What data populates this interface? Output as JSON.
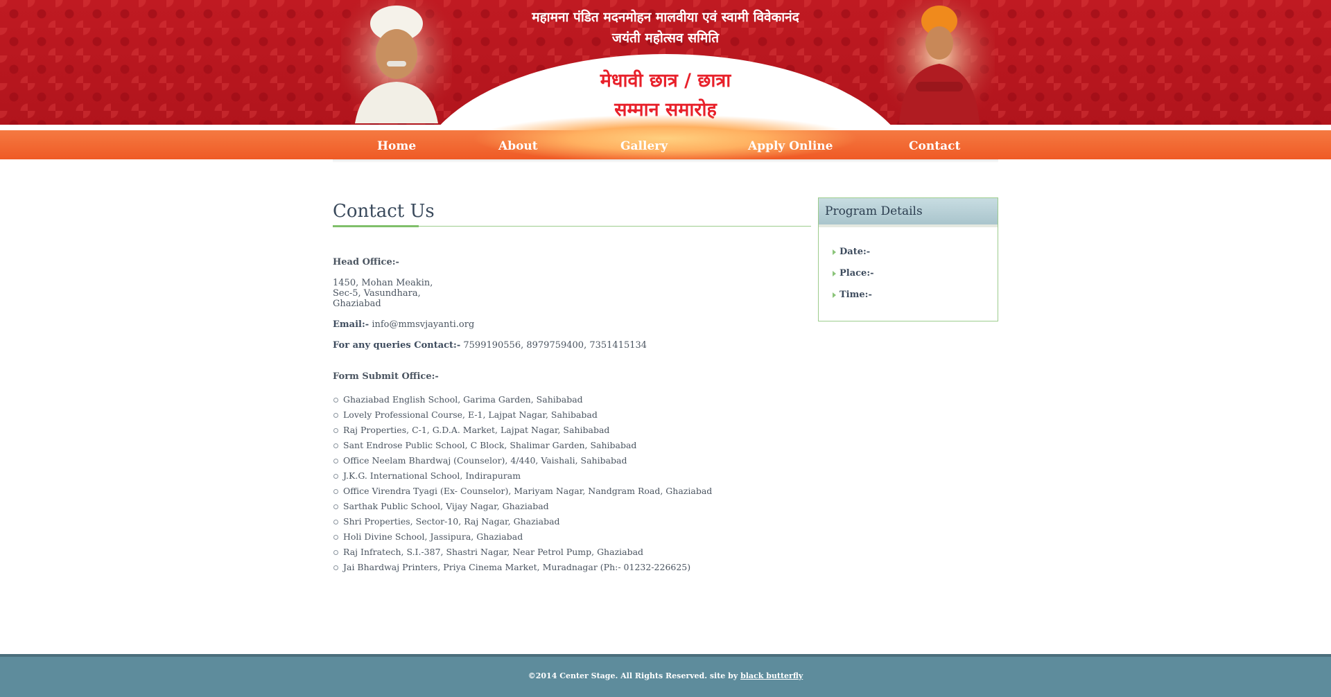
{
  "header": {
    "title_line1": "महामना पंडित मदनमोहन मालवीया एवं स्वामी विवेकानंद",
    "title_line2": "जयंती महोत्सव समिति",
    "event_line1": "मेधावी छात्र / छात्रा",
    "event_line2": "सम्मान समारोह"
  },
  "nav": {
    "items": [
      "Home",
      "About",
      "Gallery",
      "Apply Online",
      "Contact"
    ]
  },
  "main": {
    "title": "Contact Us",
    "head_office_label": "Head Office:-",
    "address": [
      "1450, Mohan Meakin,",
      "Sec-5, Vasundhara,",
      "Ghaziabad"
    ],
    "email_label": "Email:-",
    "email_value": "info@mmsvjayanti.org",
    "queries_label": "For any queries Contact:-",
    "queries_value": "7599190556, 8979759400, 7351415134",
    "form_office_label": "Form Submit Office:-",
    "offices": [
      "Ghaziabad English School, Garima Garden, Sahibabad",
      "Lovely Professional Course, E-1, Lajpat Nagar, Sahibabad",
      "Raj Properties, C-1, G.D.A. Market, Lajpat Nagar, Sahibabad",
      "Sant Endrose Public School, C Block, Shalimar Garden, Sahibabad",
      "Office Neelam Bhardwaj (Counselor), 4/440, Vaishali, Sahibabad",
      "J.K.G. International School, Indirapuram",
      "Office Virendra Tyagi (Ex- Counselor), Mariyam Nagar, Nandgram Road, Ghaziabad",
      "Sarthak Public School, Vijay Nagar, Ghaziabad",
      "Shri Properties, Sector-10, Raj Nagar, Ghaziabad",
      "Holi Divine School, Jassipura, Ghaziabad",
      "Raj Infratech, S.I.-387, Shastri Nagar, Near Petrol Pump, Ghaziabad",
      "Jai Bhardwaj Printers, Priya Cinema Market, Muradnagar (Ph:- 01232-226625)"
    ]
  },
  "sidebar": {
    "title": "Program Details",
    "items": [
      "Date:-",
      "Place:-",
      "Time:-"
    ]
  },
  "footer": {
    "text": "©2014 Center Stage. All Rights Reserved. site by",
    "link": "black butterfly"
  },
  "colors": {
    "header_red": "#b8161c",
    "nav_orange": "#ef5a25",
    "footer_teal": "#5e8c9c",
    "accent_green": "#9ccc8c"
  }
}
